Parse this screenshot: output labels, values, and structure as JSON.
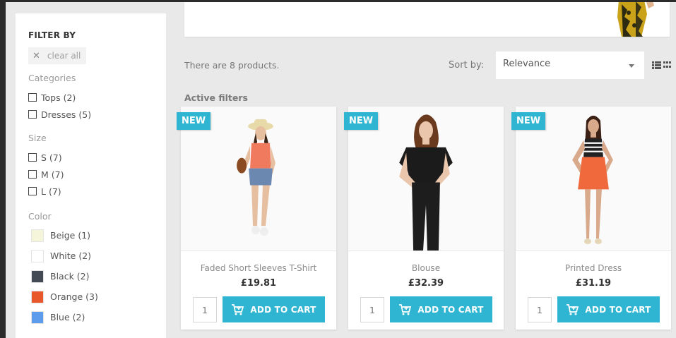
{
  "sidebar": {
    "title": "FILTER BY",
    "clear_all": "clear all",
    "categories": {
      "title": "Categories",
      "items": [
        {
          "label": "Tops (2)"
        },
        {
          "label": "Dresses (5)"
        }
      ]
    },
    "size": {
      "title": "Size",
      "items": [
        {
          "label": "S (7)"
        },
        {
          "label": "M (7)"
        },
        {
          "label": "L (7)"
        }
      ]
    },
    "color": {
      "title": "Color",
      "items": [
        {
          "label": "Beige (1)",
          "swatch": "#f5f5dc"
        },
        {
          "label": "White (2)",
          "swatch": "#ffffff"
        },
        {
          "label": "Black (2)",
          "swatch": "#434a54"
        },
        {
          "label": "Orange (3)",
          "swatch": "#e8582a"
        },
        {
          "label": "Blue (2)",
          "swatch": "#5d9cec"
        }
      ]
    }
  },
  "listing": {
    "count_text": "There are 8 products.",
    "sort_label": "Sort by:",
    "sort_value": "Relevance",
    "active_filters": "Active filters"
  },
  "products": [
    {
      "badge": "NEW",
      "name": "Faded Short Sleeves T-Shirt",
      "price": "£19.81",
      "qty": "1",
      "button": "ADD TO CART"
    },
    {
      "badge": "NEW",
      "name": "Blouse",
      "price": "£32.39",
      "qty": "1",
      "button": "ADD TO CART"
    },
    {
      "badge": "NEW",
      "name": "Printed Dress",
      "price": "£31.19",
      "qty": "1",
      "button": "ADD TO CART"
    }
  ],
  "colors": {
    "accent": "#2fb5d2",
    "background": "#e9e9e9"
  }
}
